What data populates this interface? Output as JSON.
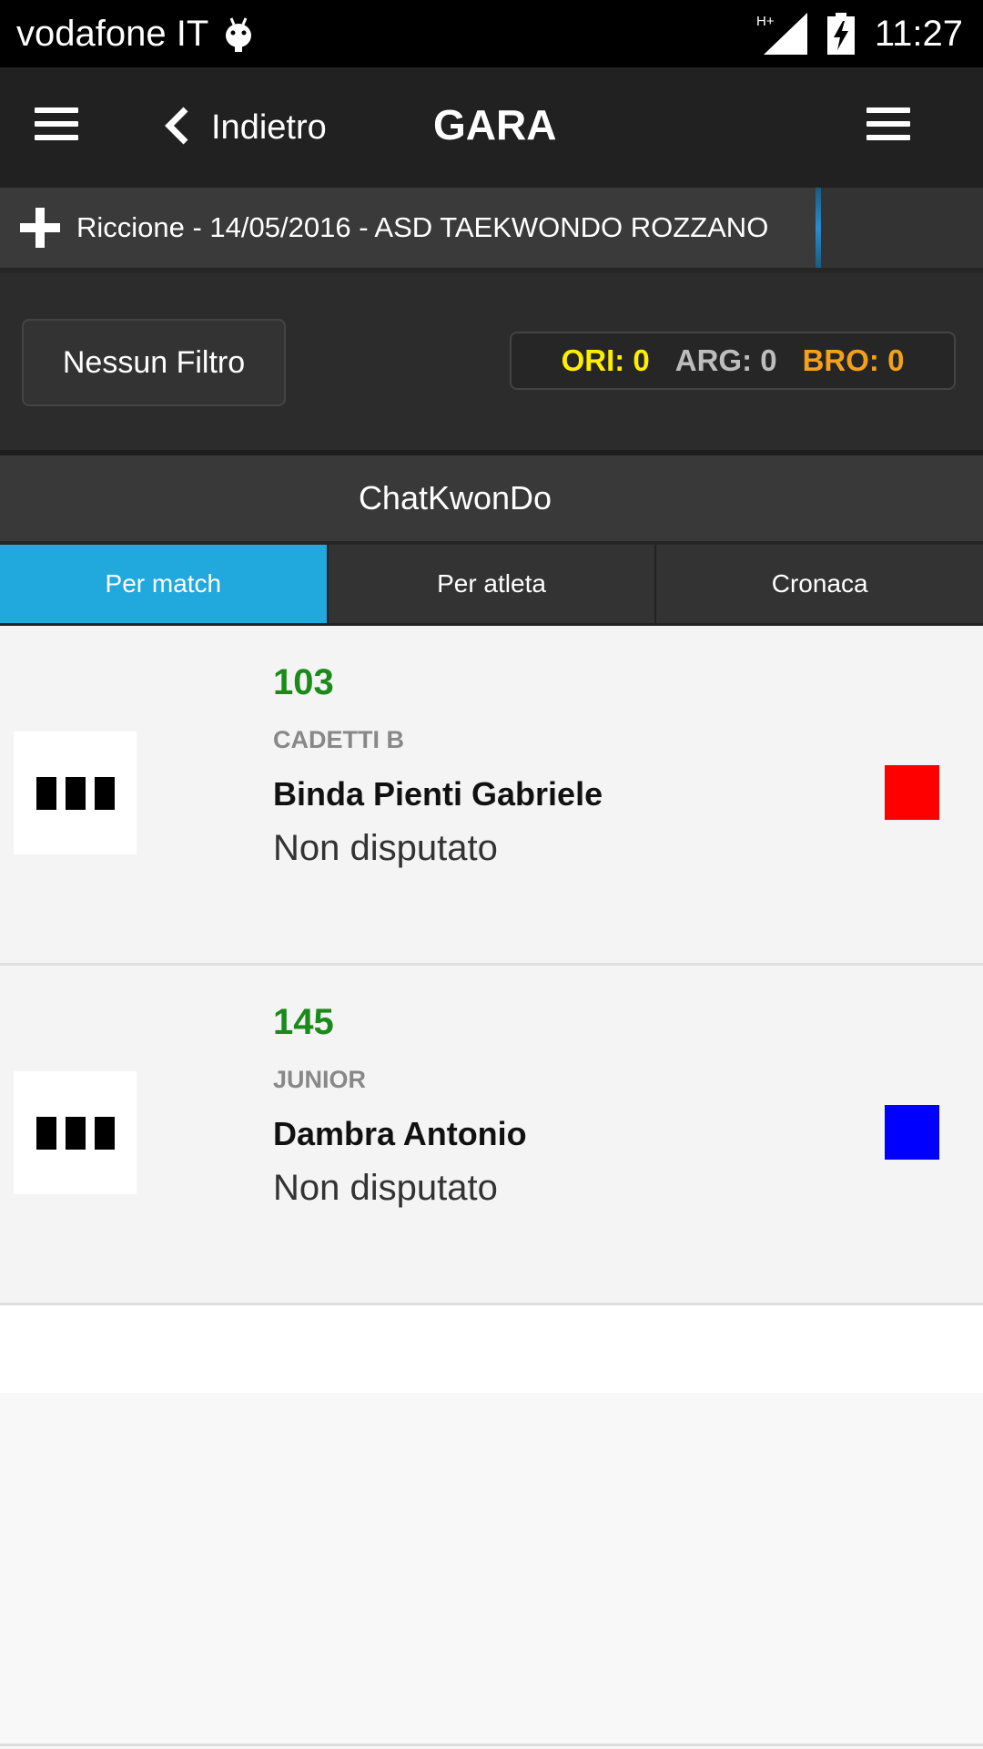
{
  "status_bar": {
    "carrier": "vodafone IT",
    "time": "11:27",
    "network": "H+"
  },
  "header": {
    "back_label": "Indietro",
    "title": "GARA"
  },
  "event": {
    "label": "Riccione - 14/05/2016 - ASD TAEKWONDO ROZZANO"
  },
  "filter": {
    "button_label": "Nessun Filtro",
    "medals": {
      "gold": "ORI: 0",
      "silver": "ARG: 0",
      "bronze": "BRO: 0",
      "gold_color": "#ffee00",
      "silver_color": "#bdbdbd",
      "bronze_color": "#f3a11a"
    }
  },
  "section": {
    "title": "ChatKwonDo"
  },
  "tabs": [
    {
      "label": "Per match",
      "active": true
    },
    {
      "label": "Per atleta",
      "active": false
    },
    {
      "label": "Cronaca",
      "active": false
    }
  ],
  "matches": [
    {
      "number": "103",
      "category": "CADETTI B",
      "athlete": "Binda Pienti Gabriele",
      "status": "Non disputato",
      "corner_color": "#ff0000"
    },
    {
      "number": "145",
      "category": "JUNIOR",
      "athlete": "Dambra Antonio",
      "status": "Non disputato",
      "corner_color": "#0000ff"
    }
  ],
  "colors": {
    "accent": "#21a8dd",
    "match_number": "#1a8a1a"
  }
}
